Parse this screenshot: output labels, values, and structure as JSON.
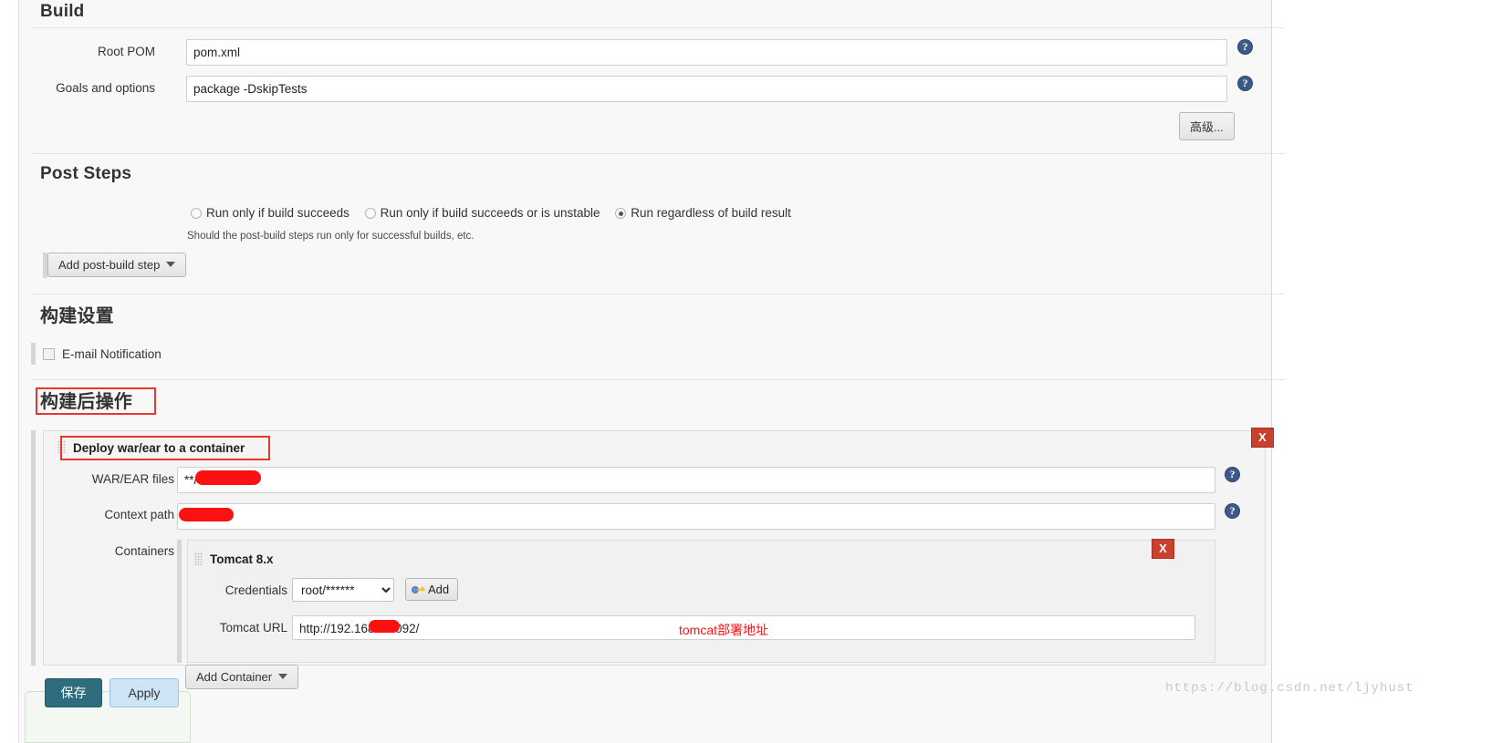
{
  "build": {
    "title": "Build",
    "root_pom": {
      "label": "Root POM",
      "value": "pom.xml"
    },
    "goals": {
      "label": "Goals and options",
      "value": "package -DskipTests"
    },
    "advanced_button": "高级..."
  },
  "post_steps": {
    "title": "Post Steps",
    "radios": [
      {
        "label": "Run only if build succeeds",
        "checked": false
      },
      {
        "label": "Run only if build succeeds or is unstable",
        "checked": false
      },
      {
        "label": "Run regardless of build result",
        "checked": true
      }
    ],
    "hint": "Should the post-build steps run only for successful builds, etc.",
    "add_step_button": "Add post-build step"
  },
  "build_settings": {
    "title": "构建设置",
    "email_notification": {
      "label": "E-mail Notification",
      "checked": false
    }
  },
  "post_build_actions": {
    "title": "构建后操作",
    "deploy": {
      "title": "Deploy war/ear to a container",
      "delete_button": "X",
      "war_files": {
        "label": "WAR/EAR files",
        "value": "**/e              ar"
      },
      "context_path": {
        "label": "Context path",
        "value": ""
      },
      "containers_label": "Containers",
      "container": {
        "title": "Tomcat 8.x",
        "delete_button": "X",
        "credentials": {
          "label": "Credentials",
          "selected": "root/******",
          "options": [
            "root/******"
          ],
          "add_button": "Add"
        },
        "tomcat_url": {
          "label": "Tomcat URL",
          "value": "http://192.168       :10092/",
          "annotation": "tomcat部署地址"
        }
      },
      "add_container_button": "Add Container"
    }
  },
  "footer": {
    "save_button": "保存",
    "apply_button": "Apply"
  },
  "watermark": "https://blog.csdn.net/ljyhust",
  "colors": {
    "accent_red": "#fb1111",
    "annotation_box": "#e23a2e",
    "delete_button": "#c9402f",
    "save_button": "#2e6d7d",
    "apply_button": "#cfe3f7",
    "help_icon": "#3c5a88"
  }
}
